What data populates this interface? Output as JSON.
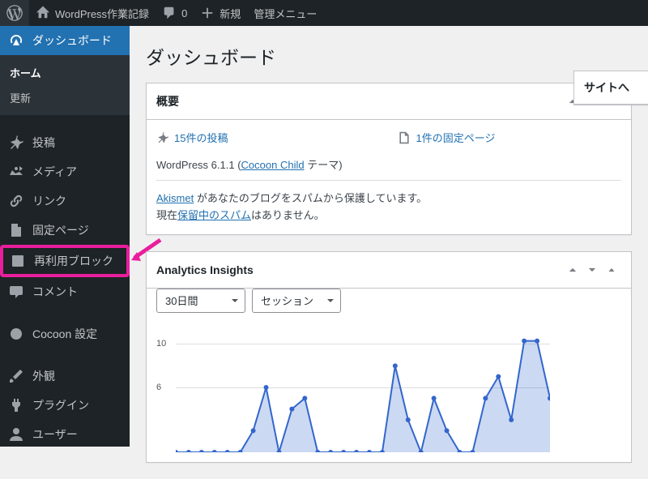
{
  "adminbar": {
    "site_title": "WordPress作業記録",
    "comments_count": "0",
    "new_label": "新規",
    "admin_menu_label": "管理メニュー"
  },
  "sidebar": {
    "dashboard": "ダッシュボード",
    "submenu": {
      "home": "ホーム",
      "updates": "更新"
    },
    "posts": "投稿",
    "media": "メディア",
    "links": "リンク",
    "pages": "固定ページ",
    "reusable_blocks": "再利用ブロック",
    "comments": "コメント",
    "cocoon": "Cocoon 設定",
    "appearance": "外観",
    "plugins": "プラグイン",
    "users": "ユーザー"
  },
  "page_title": "ダッシュボード",
  "overview": {
    "title": "概要",
    "posts": "15件の投稿",
    "pages": "1件の固定ページ",
    "version_prefix": "WordPress 6.1.1 (",
    "theme_link": "Cocoon Child",
    "version_suffix": " テーマ)",
    "akismet_link": "Akismet",
    "akismet_text": " があなたのブログをスパムから保護しています。",
    "spam_prefix": "現在",
    "spam_link": "保留中のスパム",
    "spam_suffix": "はありません。"
  },
  "analytics": {
    "title": "Analytics Insights",
    "period": "30日間",
    "metric": "セッション"
  },
  "side_panel": {
    "title": "サイトへ"
  },
  "chart_data": {
    "type": "line",
    "title": "",
    "xlabel": "",
    "ylabel": "",
    "ylim": [
      0,
      12
    ],
    "yticks": [
      6,
      10
    ],
    "x": [
      0,
      1,
      2,
      3,
      4,
      5,
      6,
      7,
      8,
      9,
      10,
      11,
      12,
      13,
      14,
      15,
      16,
      17,
      18,
      19,
      20,
      21,
      22,
      23,
      24,
      25,
      26,
      27,
      28,
      29
    ],
    "values": [
      0,
      0,
      0,
      0,
      0,
      0,
      2,
      6,
      0,
      4,
      5,
      0,
      0,
      0,
      0,
      0,
      0,
      8,
      3,
      0,
      5,
      2,
      0,
      0,
      5,
      7,
      3,
      10.3,
      10.3,
      5
    ]
  }
}
